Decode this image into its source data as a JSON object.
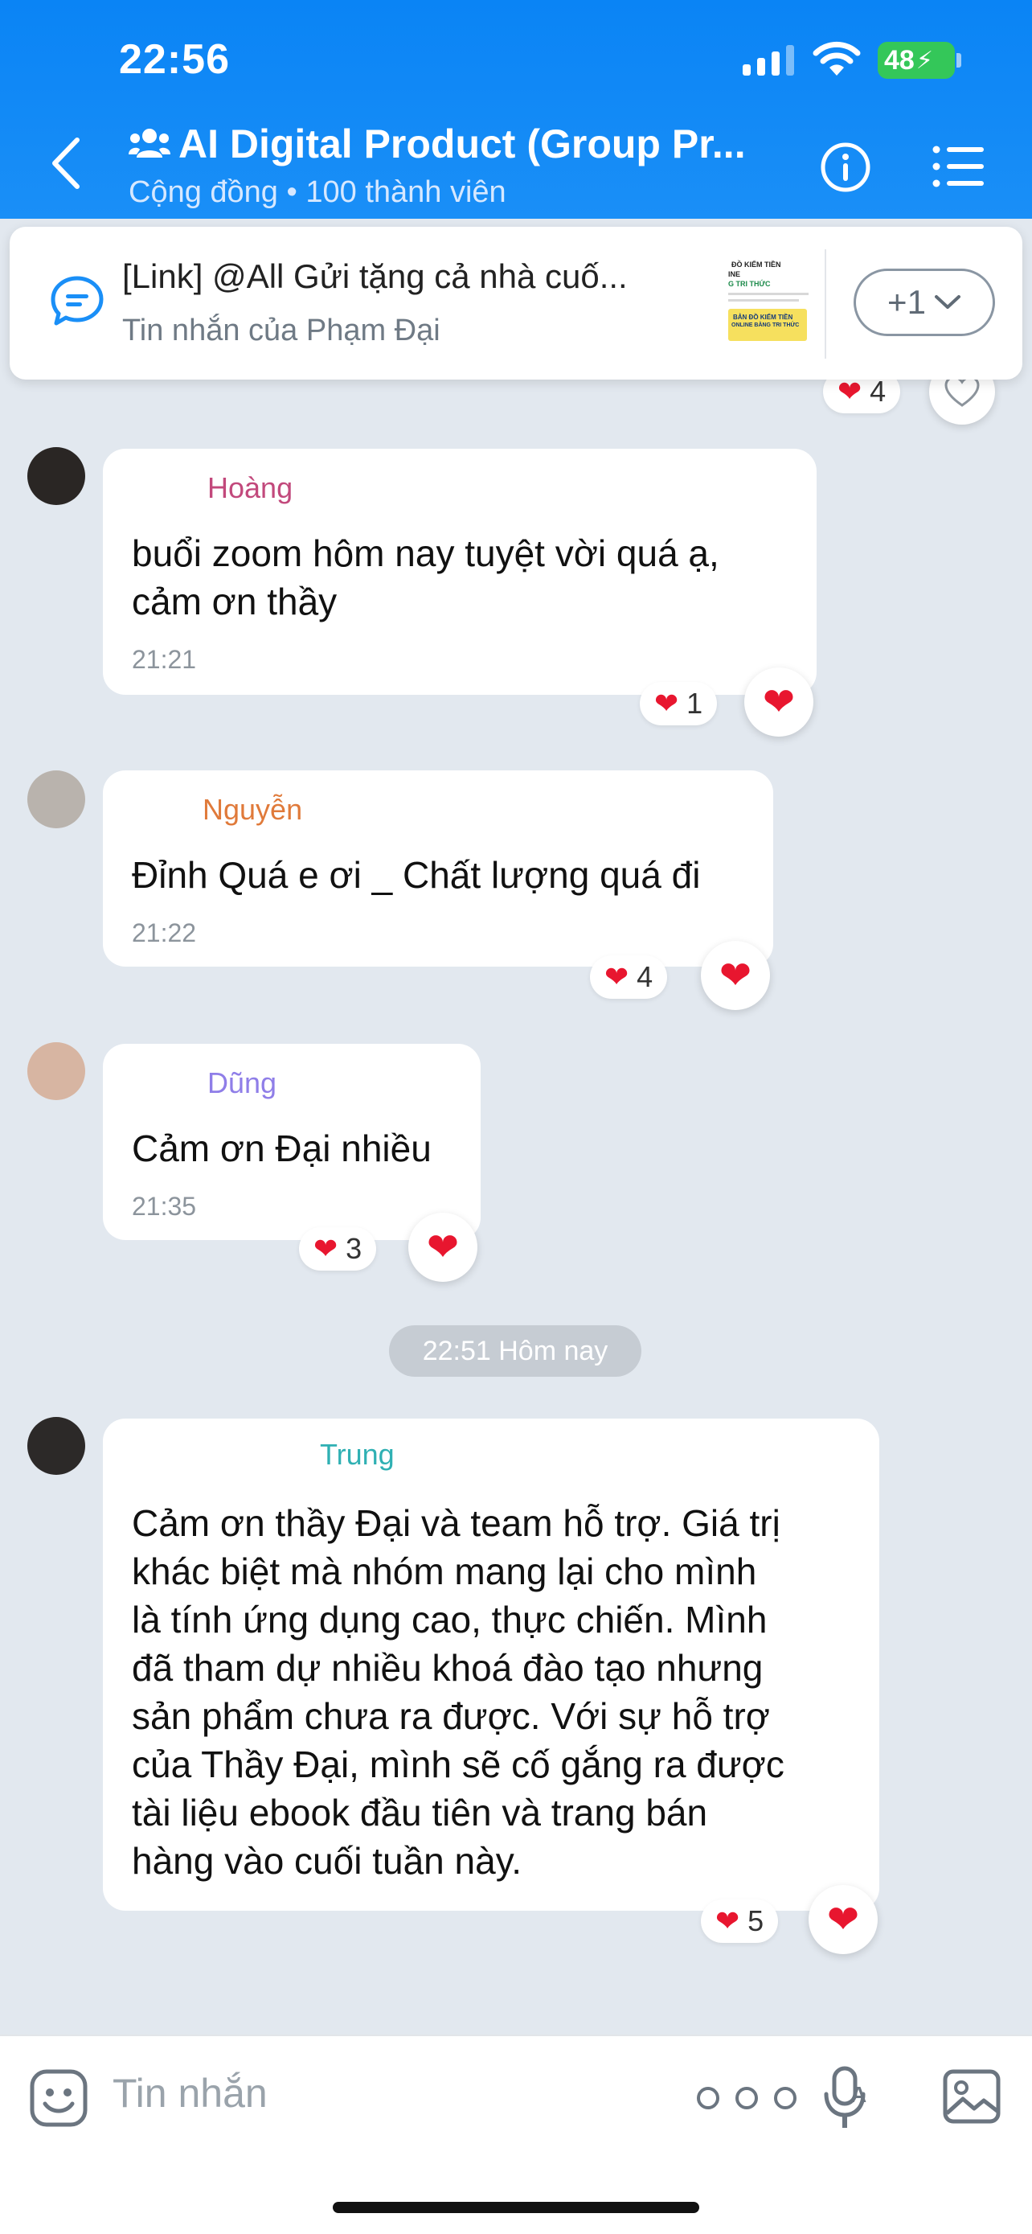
{
  "status_bar": {
    "time": "22:56",
    "battery": "48"
  },
  "header": {
    "title": "AI Digital Product (Group Pr...",
    "subtitle": "Cộng đồng • 100 thành viên"
  },
  "pinned": {
    "title": "[Link] @All Gửi tặng cả nhà cuố...",
    "subtitle": "Tin nhắn của Phạm Đại",
    "more": "+1",
    "reaction_count": "4",
    "thumb_lines": [
      "ĐỒ KIẾM TIỀN",
      "INE",
      "G TRI THỨC",
      "BẢN ĐỒ KIẾM TIỀN",
      "ONLINE BẰNG TRI THỨC"
    ]
  },
  "messages": [
    {
      "sender": "Hoàng",
      "sender_color": "#c2497c",
      "text_lines": [
        "buổi zoom hôm nay tuyệt vời quá ạ,",
        "cảm ơn thầy"
      ],
      "time": "21:21",
      "reaction_count": "1"
    },
    {
      "sender": "Nguyễn",
      "sender_color": "#e07a3a",
      "text_lines": [
        "Đỉnh Quá e ơi _ Chất lượng quá đi"
      ],
      "time": "21:22",
      "reaction_count": "4"
    },
    {
      "sender": "Dũng",
      "sender_color": "#8f7ee8",
      "text_lines": [
        "Cảm ơn Đại nhiều"
      ],
      "time": "21:35",
      "reaction_count": "3"
    },
    {
      "sender": "Trung",
      "sender_color": "#2fb0b3",
      "text_lines": [
        "Cảm ơn thầy Đại và team hỗ trợ. Giá trị",
        "khác biệt mà nhóm mang lại cho mình",
        "là tính ứng dụng cao, thực chiến. Mình",
        "đã tham dự nhiều khoá đào tạo nhưng",
        "sản phẩm chưa ra được. Với sự hỗ trợ",
        "của Thầy Đại, mình sẽ cố gắng ra được",
        "tài liệu ebook đầu tiên và trang bán",
        "hàng vào cuối tuần này."
      ],
      "reaction_count": "5"
    }
  ],
  "date_separator": "22:51 Hôm nay",
  "composer": {
    "placeholder": "Tin nhắn"
  },
  "icons": {
    "back": "chevron-left-icon",
    "group": "group-icon",
    "info": "info-icon",
    "menu": "list-icon",
    "pinned": "chat-bubble-icon",
    "heart": "heart-icon",
    "emoji": "emoji-icon",
    "more": "more-icon",
    "voice": "voice-icon",
    "image": "image-icon"
  },
  "colors": {
    "header": "#0a84f5",
    "heart": "#e8162f",
    "background": "#e2e8ef"
  }
}
